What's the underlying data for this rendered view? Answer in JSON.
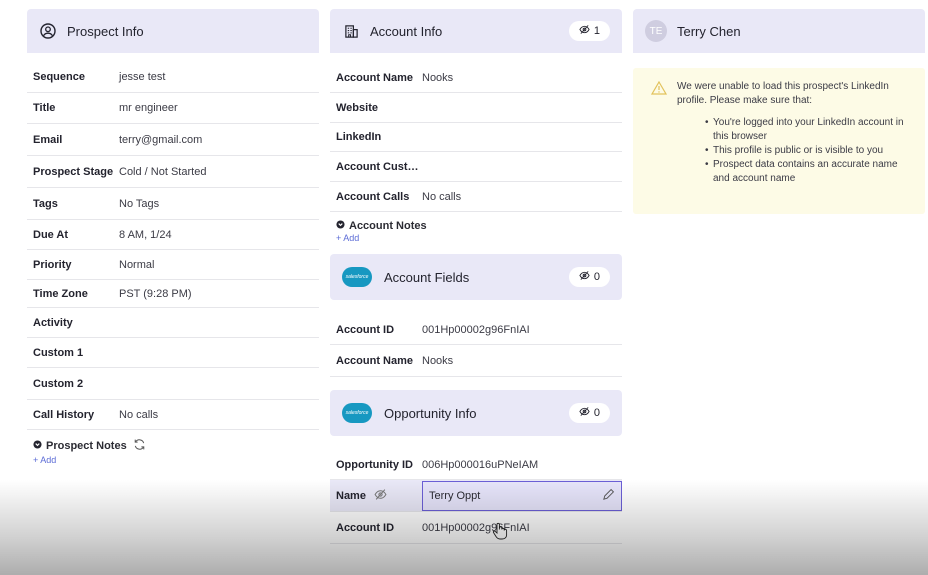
{
  "prospect": {
    "header": "Prospect Info",
    "rows": [
      {
        "label": "Sequence",
        "value": "jesse test"
      },
      {
        "label": "Title",
        "value": "mr engineer"
      },
      {
        "label": "Email",
        "value": "terry@gmail.com"
      },
      {
        "label": "Prospect Stage",
        "value": "Cold / Not Started"
      },
      {
        "label": "Tags",
        "value": "No Tags"
      },
      {
        "label": "Due At",
        "value": "8 AM, 1/24"
      },
      {
        "label": "Priority",
        "value": "Normal"
      },
      {
        "label": "Time Zone",
        "value": "PST (9:28 PM)"
      },
      {
        "label": "Activity",
        "value": ""
      },
      {
        "label": "Custom 1",
        "value": ""
      },
      {
        "label": "Custom 2",
        "value": ""
      },
      {
        "label": "Call History",
        "value": "No calls"
      }
    ],
    "notes_title": "Prospect Notes",
    "add_label": "+ Add"
  },
  "account": {
    "header": "Account Info",
    "badge": "1",
    "rows": [
      {
        "label": "Account Name",
        "value": "Nooks"
      },
      {
        "label": "Website",
        "value": ""
      },
      {
        "label": "LinkedIn",
        "value": ""
      },
      {
        "label": "Account Custo...",
        "value": ""
      },
      {
        "label": "Account Calls",
        "value": "No calls"
      }
    ],
    "notes_title": "Account Notes",
    "add_label": "+ Add"
  },
  "account_fields": {
    "logo_text": "salesforce",
    "header": "Account Fields",
    "badge": "0",
    "rows": [
      {
        "label": "Account ID",
        "value": "001Hp00002g96FnIAI"
      },
      {
        "label": "Account Name",
        "value": "Nooks"
      }
    ]
  },
  "opportunity": {
    "logo_text": "salesforce",
    "header": "Opportunity Info",
    "badge": "0",
    "rows": [
      {
        "label": "Opportunity ID",
        "value": "006Hp000016uPNeIAM"
      },
      {
        "label": "Name",
        "value": "Terry Oppt"
      },
      {
        "label": "Account ID",
        "value": "001Hp00002g96FnIAI"
      }
    ]
  },
  "linkedin": {
    "avatar": "TE",
    "name": "Terry Chen",
    "message": "We were unable to load this prospect's LinkedIn profile. Please make sure that:",
    "bullets": [
      "You're logged into your LinkedIn account in this browser",
      "This profile is public or is visible to you",
      "Prospect data contains an accurate name and account name"
    ]
  },
  "colors": {
    "panel_header": "#e9e8f7",
    "warning_bg": "#fdfbe6",
    "accent": "#6b5fd6",
    "salesforce": "#1798c1"
  }
}
